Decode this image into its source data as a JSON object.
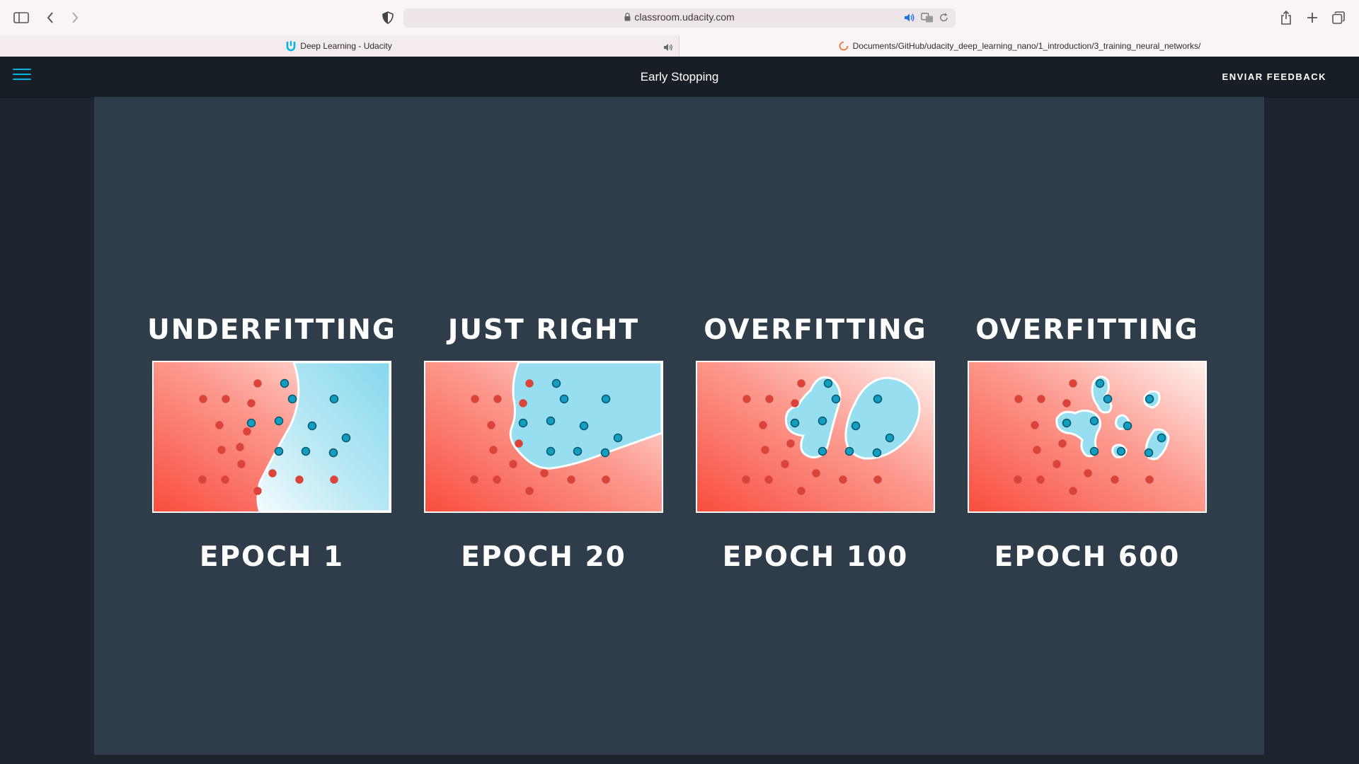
{
  "browser": {
    "url": "classroom.udacity.com",
    "tabs": [
      {
        "label": "Deep Learning - Udacity"
      },
      {
        "label": "Documents/GitHub/udacity_deep_learning_nano/1_introduction/3_training_neural_networks/"
      }
    ],
    "icons": [
      "sidebar-icon",
      "back-icon",
      "forward-icon",
      "shield-icon",
      "lock-icon",
      "audio-icon",
      "translate-icon",
      "reload-icon",
      "share-icon",
      "new-tab-icon",
      "tab-overview-icon",
      "udacity-logo-icon",
      "loading-icon"
    ]
  },
  "header": {
    "title": "Early Stopping",
    "feedback_label": "ENVIAR FEEDBACK",
    "accent_color": "#02b3e4"
  },
  "slide": {
    "panels": [
      {
        "title": "UNDERFITTING",
        "epoch": "EPOCH 1"
      },
      {
        "title": "JUST RIGHT",
        "epoch": "EPOCH 20"
      },
      {
        "title": "OVERFITTING",
        "epoch": "EPOCH 100"
      },
      {
        "title": "OVERFITTING",
        "epoch": "EPOCH 600"
      }
    ],
    "colors": {
      "red_region": "#f8564a",
      "blue_region": "#8fdcef",
      "red_point": "#e1463d",
      "blue_point": "#0e9bbd"
    }
  }
}
